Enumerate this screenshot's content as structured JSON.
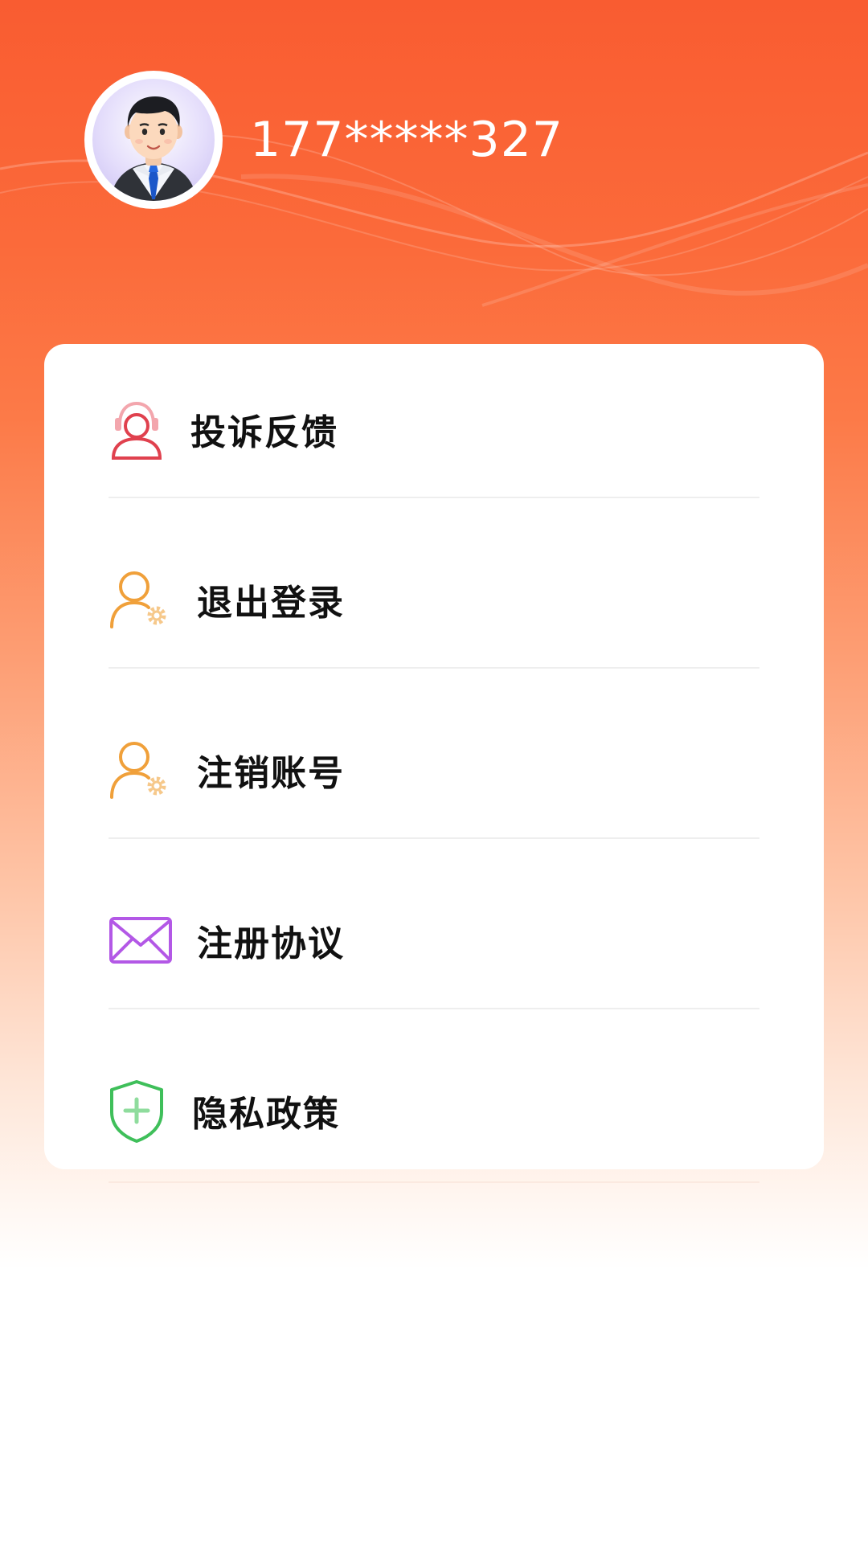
{
  "profile": {
    "phone": "177*****327"
  },
  "menu": {
    "items": [
      {
        "label": "投诉反馈",
        "icon": "customer-service-icon"
      },
      {
        "label": "退出登录",
        "icon": "user-settings-icon"
      },
      {
        "label": "注销账号",
        "icon": "user-settings-icon"
      },
      {
        "label": "注册协议",
        "icon": "envelope-icon"
      },
      {
        "label": "隐私政策",
        "icon": "shield-plus-icon"
      }
    ]
  },
  "colors": {
    "header_orange": "#f95c31",
    "icon_red": "#e0414e",
    "icon_orange": "#f0a03a",
    "icon_purple": "#b358e6",
    "icon_green": "#3fbf5a"
  }
}
